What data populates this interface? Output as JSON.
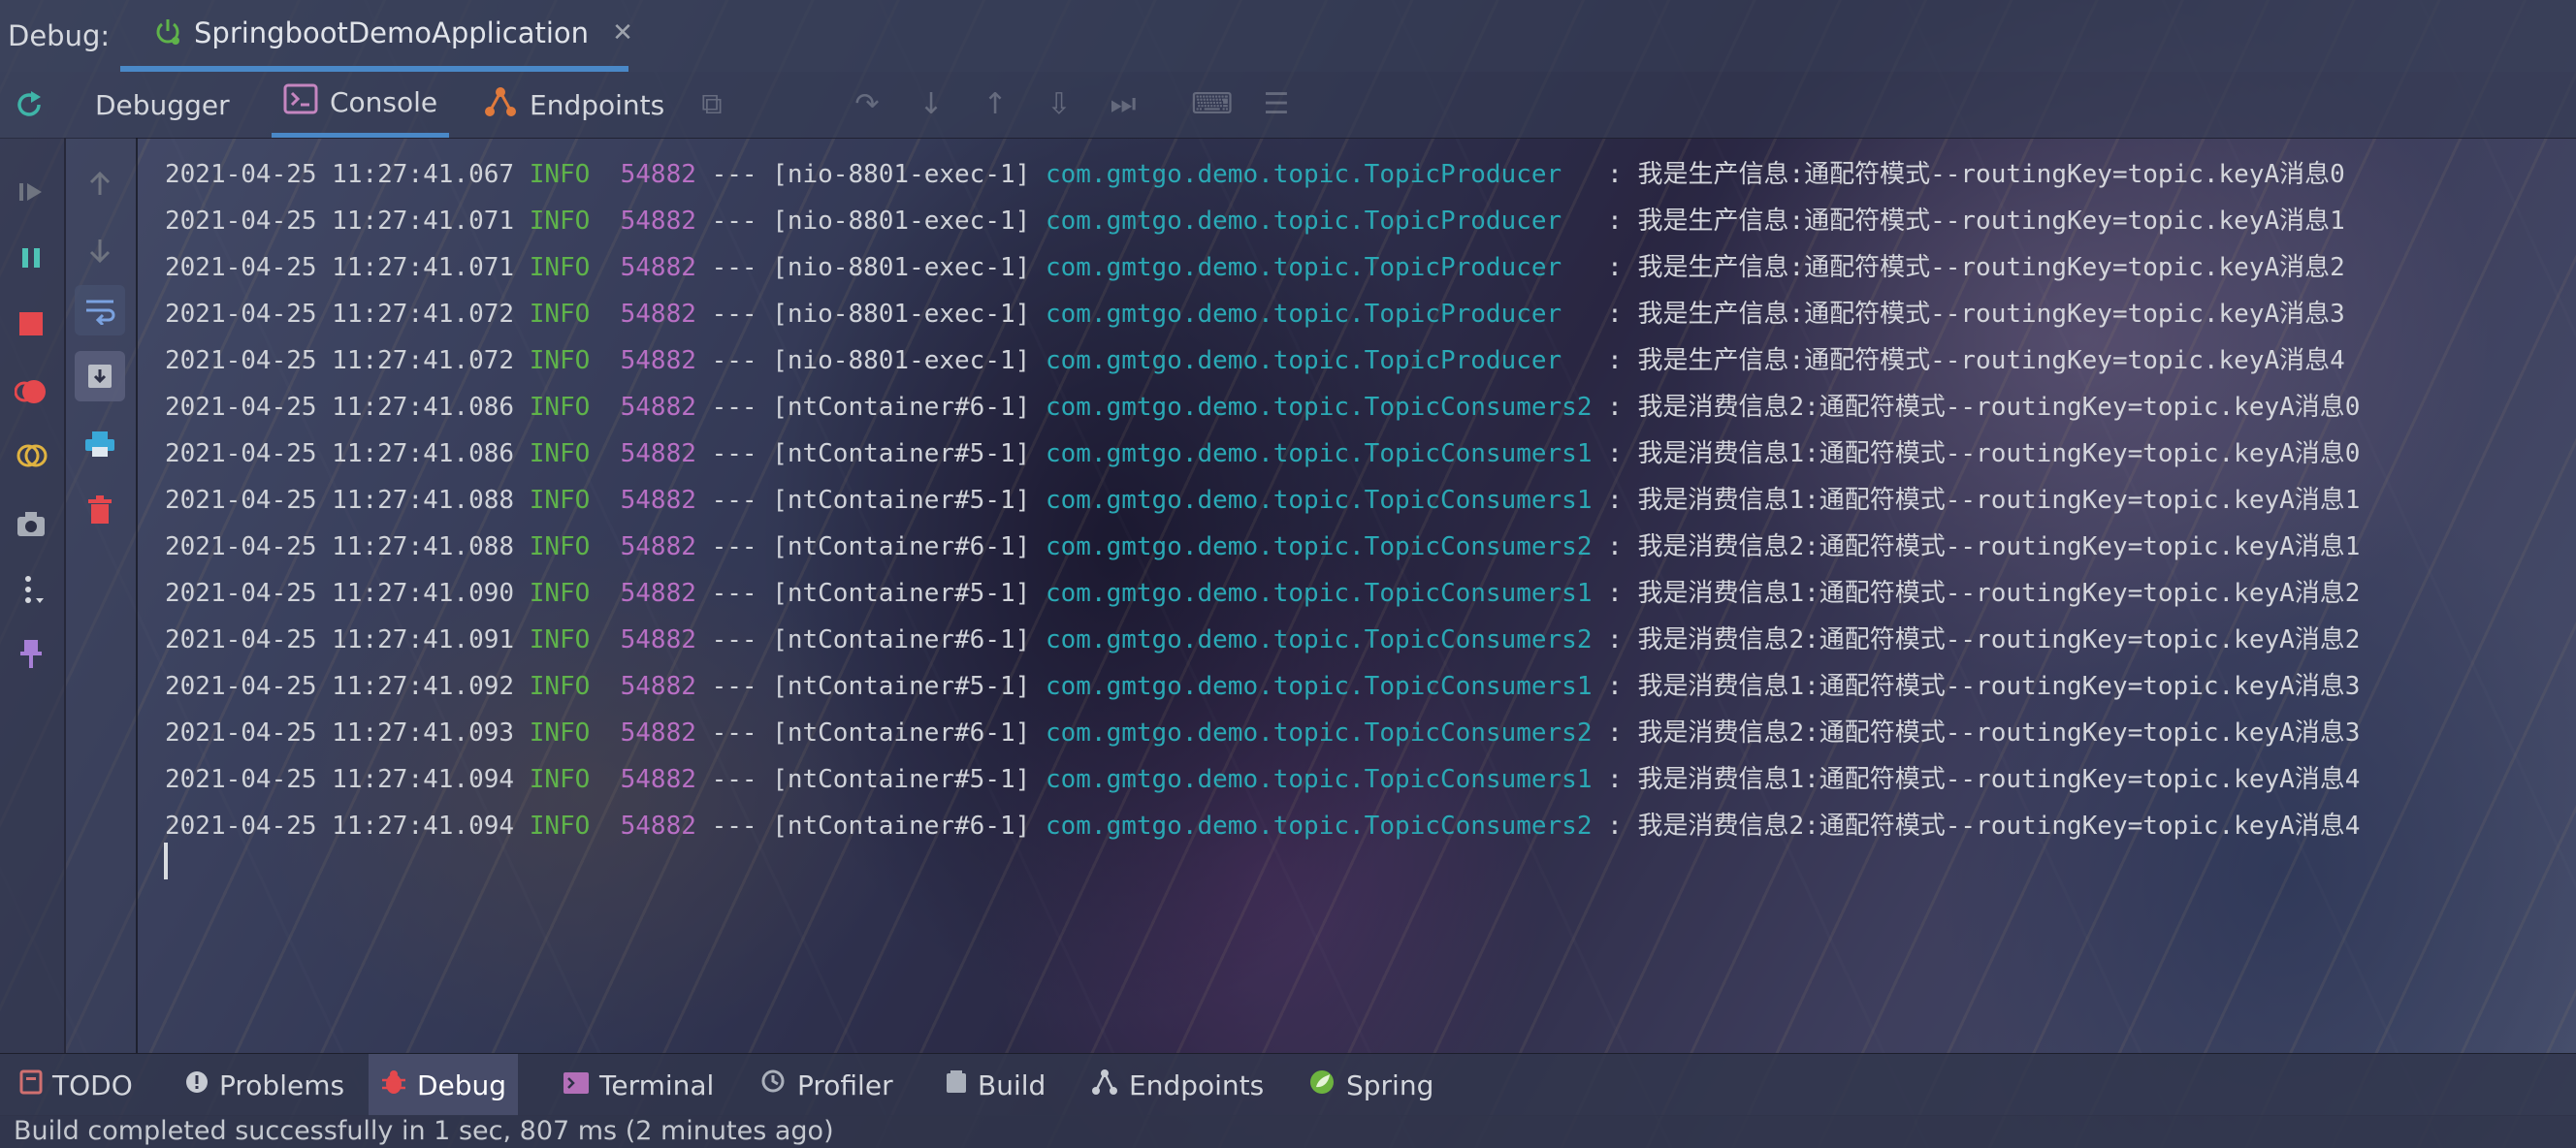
{
  "titlebar": {
    "label": "Debug:",
    "run_config": "SpringbootDemoApplication",
    "close_glyph": "✕"
  },
  "toolbar": {
    "tabs": [
      {
        "label": "Debugger",
        "icon": "none"
      },
      {
        "label": "Console",
        "icon": "console-icon",
        "active": true
      },
      {
        "label": "Endpoints",
        "icon": "endpoints-icon"
      }
    ]
  },
  "leftbar_icons": [
    "rerun-icon",
    "resume-icon",
    "pause-icon",
    "stop-icon",
    "view-breakpoints-icon",
    "mute-breakpoints-icon",
    "camera-icon",
    "more-icon",
    "pin-icon"
  ],
  "gutter_icons": [
    "up-arrow-icon",
    "down-arrow-icon",
    "soft-wrap-icon",
    "scroll-to-end-icon",
    "print-icon",
    "trash-icon"
  ],
  "log_lines": [
    {
      "ts": "2021-04-25 11:27:41.067",
      "level": "INFO",
      "pid": "54882",
      "sep": "---",
      "thread": "[nio-8801-exec-1]",
      "cls": "com.gmtgo.demo.topic.TopicProducer",
      "msg": ": 我是生产信息:通配符模式--routingKey=topic.keyA消息0"
    },
    {
      "ts": "2021-04-25 11:27:41.071",
      "level": "INFO",
      "pid": "54882",
      "sep": "---",
      "thread": "[nio-8801-exec-1]",
      "cls": "com.gmtgo.demo.topic.TopicProducer",
      "msg": ": 我是生产信息:通配符模式--routingKey=topic.keyA消息1"
    },
    {
      "ts": "2021-04-25 11:27:41.071",
      "level": "INFO",
      "pid": "54882",
      "sep": "---",
      "thread": "[nio-8801-exec-1]",
      "cls": "com.gmtgo.demo.topic.TopicProducer",
      "msg": ": 我是生产信息:通配符模式--routingKey=topic.keyA消息2"
    },
    {
      "ts": "2021-04-25 11:27:41.072",
      "level": "INFO",
      "pid": "54882",
      "sep": "---",
      "thread": "[nio-8801-exec-1]",
      "cls": "com.gmtgo.demo.topic.TopicProducer",
      "msg": ": 我是生产信息:通配符模式--routingKey=topic.keyA消息3"
    },
    {
      "ts": "2021-04-25 11:27:41.072",
      "level": "INFO",
      "pid": "54882",
      "sep": "---",
      "thread": "[nio-8801-exec-1]",
      "cls": "com.gmtgo.demo.topic.TopicProducer",
      "msg": ": 我是生产信息:通配符模式--routingKey=topic.keyA消息4"
    },
    {
      "ts": "2021-04-25 11:27:41.086",
      "level": "INFO",
      "pid": "54882",
      "sep": "---",
      "thread": "[ntContainer#6-1]",
      "cls": "com.gmtgo.demo.topic.TopicConsumers2",
      "msg": ": 我是消费信息2:通配符模式--routingKey=topic.keyA消息0"
    },
    {
      "ts": "2021-04-25 11:27:41.086",
      "level": "INFO",
      "pid": "54882",
      "sep": "---",
      "thread": "[ntContainer#5-1]",
      "cls": "com.gmtgo.demo.topic.TopicConsumers1",
      "msg": ": 我是消费信息1:通配符模式--routingKey=topic.keyA消息0"
    },
    {
      "ts": "2021-04-25 11:27:41.088",
      "level": "INFO",
      "pid": "54882",
      "sep": "---",
      "thread": "[ntContainer#5-1]",
      "cls": "com.gmtgo.demo.topic.TopicConsumers1",
      "msg": ": 我是消费信息1:通配符模式--routingKey=topic.keyA消息1"
    },
    {
      "ts": "2021-04-25 11:27:41.088",
      "level": "INFO",
      "pid": "54882",
      "sep": "---",
      "thread": "[ntContainer#6-1]",
      "cls": "com.gmtgo.demo.topic.TopicConsumers2",
      "msg": ": 我是消费信息2:通配符模式--routingKey=topic.keyA消息1"
    },
    {
      "ts": "2021-04-25 11:27:41.090",
      "level": "INFO",
      "pid": "54882",
      "sep": "---",
      "thread": "[ntContainer#5-1]",
      "cls": "com.gmtgo.demo.topic.TopicConsumers1",
      "msg": ": 我是消费信息1:通配符模式--routingKey=topic.keyA消息2"
    },
    {
      "ts": "2021-04-25 11:27:41.091",
      "level": "INFO",
      "pid": "54882",
      "sep": "---",
      "thread": "[ntContainer#6-1]",
      "cls": "com.gmtgo.demo.topic.TopicConsumers2",
      "msg": ": 我是消费信息2:通配符模式--routingKey=topic.keyA消息2"
    },
    {
      "ts": "2021-04-25 11:27:41.092",
      "level": "INFO",
      "pid": "54882",
      "sep": "---",
      "thread": "[ntContainer#5-1]",
      "cls": "com.gmtgo.demo.topic.TopicConsumers1",
      "msg": ": 我是消费信息1:通配符模式--routingKey=topic.keyA消息3"
    },
    {
      "ts": "2021-04-25 11:27:41.093",
      "level": "INFO",
      "pid": "54882",
      "sep": "---",
      "thread": "[ntContainer#6-1]",
      "cls": "com.gmtgo.demo.topic.TopicConsumers2",
      "msg": ": 我是消费信息2:通配符模式--routingKey=topic.keyA消息3"
    },
    {
      "ts": "2021-04-25 11:27:41.094",
      "level": "INFO",
      "pid": "54882",
      "sep": "---",
      "thread": "[ntContainer#5-1]",
      "cls": "com.gmtgo.demo.topic.TopicConsumers1",
      "msg": ": 我是消费信息1:通配符模式--routingKey=topic.keyA消息4"
    },
    {
      "ts": "2021-04-25 11:27:41.094",
      "level": "INFO",
      "pid": "54882",
      "sep": "---",
      "thread": "[ntContainer#6-1]",
      "cls": "com.gmtgo.demo.topic.TopicConsumers2",
      "msg": ": 我是消费信息2:通配符模式--routingKey=topic.keyA消息4"
    }
  ],
  "bottombar": {
    "items": [
      {
        "label": "TODO",
        "icon": "todo-icon"
      },
      {
        "label": "Problems",
        "icon": "problems-icon"
      },
      {
        "label": "Debug",
        "icon": "bug-icon",
        "active": true
      },
      {
        "label": "Terminal",
        "icon": "terminal-icon"
      },
      {
        "label": "Profiler",
        "icon": "profiler-icon"
      },
      {
        "label": "Build",
        "icon": "build-icon"
      },
      {
        "label": "Endpoints",
        "icon": "endpoints-icon"
      },
      {
        "label": "Spring",
        "icon": "spring-icon"
      }
    ]
  },
  "status": {
    "text": "Build completed successfully in 1 sec, 807 ms (2 minutes ago)"
  },
  "colors": {
    "accent": "#4a88c7",
    "log_level": "#5fb34a",
    "log_pid": "#b86fc4",
    "log_class": "#2aa9b5",
    "stop_red": "#e5484d"
  }
}
